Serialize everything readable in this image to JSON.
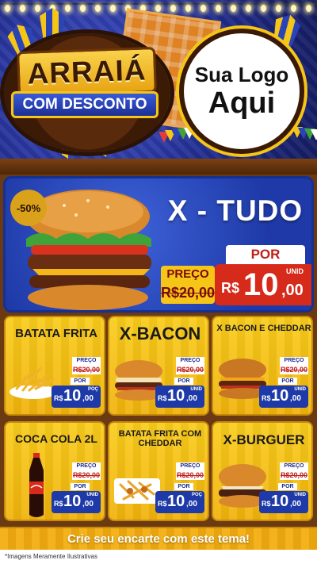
{
  "header": {
    "title_top": "ARRAIÁ",
    "title_bottom": "COM DESCONTO",
    "logo_line1": "Sua Logo",
    "logo_line2": "Aqui"
  },
  "hero": {
    "discount": "-50%",
    "product_name": "X - TUDO",
    "price_label": "PREÇO",
    "old_price": "R$20,00",
    "por_label": "POR",
    "currency": "R$",
    "new_price_int": "10",
    "new_price_cents": ",00",
    "unit": "UNID"
  },
  "products": [
    {
      "name": "BATATA FRITA",
      "price_label": "PREÇO",
      "old_price": "R$20,00",
      "por_label": "POR",
      "currency": "R$",
      "new_price_int": "10",
      "new_price_cents": ",00",
      "unit": "POÇ"
    },
    {
      "name": "X-BACON",
      "price_label": "PREÇO",
      "old_price": "R$20,00",
      "por_label": "POR",
      "currency": "R$",
      "new_price_int": "10",
      "new_price_cents": ",00",
      "unit": "UNID"
    },
    {
      "name": "X BACON E CHEDDAR",
      "price_label": "PREÇO",
      "old_price": "R$20,00",
      "por_label": "POR",
      "currency": "R$",
      "new_price_int": "10",
      "new_price_cents": ",00",
      "unit": "UNID"
    },
    {
      "name": "COCA COLA 2L",
      "price_label": "PREÇO",
      "old_price": "R$20,00",
      "por_label": "POR",
      "currency": "R$",
      "new_price_int": "10",
      "new_price_cents": ",00",
      "unit": "UNID"
    },
    {
      "name": "BATATA FRITA COM CHEDDAR",
      "price_label": "PREÇO",
      "old_price": "R$20,00",
      "por_label": "POR",
      "currency": "R$",
      "new_price_int": "10",
      "new_price_cents": ",00",
      "unit": "POÇ"
    },
    {
      "name": "X-BURGUER",
      "price_label": "PREÇO",
      "old_price": "R$20,00",
      "por_label": "POR",
      "currency": "R$",
      "new_price_int": "10",
      "new_price_cents": ",00",
      "unit": "UNID"
    }
  ],
  "footer": {
    "cta": "Crie seu encarte com este tema!",
    "disclaimer": "*Imagens Meramente Ilustrativas"
  },
  "colors": {
    "festival_blue": "#1f3aa8",
    "festival_yellow": "#f5c518",
    "price_red": "#d62a1a",
    "wood_brown": "#6b3a12"
  },
  "icons": [
    "burger-image",
    "fries-image",
    "coke-bottle-image",
    "cheddar-fries-image"
  ]
}
